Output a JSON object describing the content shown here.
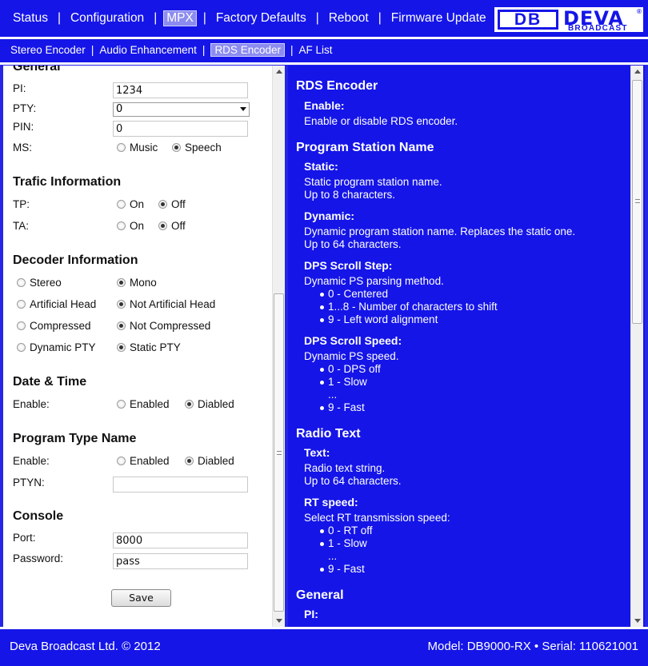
{
  "topnav": {
    "items": [
      "Status",
      "Configuration",
      "MPX",
      "Factory Defaults",
      "Reboot",
      "Firmware Update"
    ],
    "active": "MPX"
  },
  "logo": {
    "db": "DB",
    "name": "DEVA",
    "reg": "®",
    "sub": "BROADCAST"
  },
  "subnav": {
    "items": [
      "Stereo Encoder",
      "Audio Enhancement",
      "RDS Encoder",
      "AF List"
    ],
    "active": "RDS Encoder"
  },
  "form": {
    "general_heading": "General",
    "pi_label": "PI:",
    "pi_value": "1234",
    "pty_label": "PTY:",
    "pty_value": "0",
    "pin_label": "PIN:",
    "pin_value": "0",
    "ms_label": "MS:",
    "ms_music": "Music",
    "ms_speech": "Speech",
    "traffic_heading": "Trafic Information",
    "tp_label": "TP:",
    "ta_label": "TA:",
    "on": "On",
    "off": "Off",
    "decoder_heading": "Decoder Information",
    "stereo": "Stereo",
    "mono": "Mono",
    "artificial_head": "Artificial Head",
    "not_artificial_head": "Not Artificial Head",
    "compressed": "Compressed",
    "not_compressed": "Not Compressed",
    "dynamic_pty": "Dynamic PTY",
    "static_pty": "Static PTY",
    "datetime_heading": "Date & Time",
    "enable_label": "Enable:",
    "enabled": "Enabled",
    "diabled": "Diabled",
    "ptn_heading": "Program Type Name",
    "ptyn_label": "PTYN:",
    "ptyn_value": "",
    "console_heading": "Console",
    "port_label": "Port:",
    "port_value": "8000",
    "password_label": "Password:",
    "password_value": "pass",
    "save_label": "Save"
  },
  "help": {
    "rds_heading": "RDS Encoder",
    "enable_title": "Enable:",
    "enable_text": "Enable or disable RDS encoder.",
    "psn_heading": "Program Station Name",
    "static_title": "Static:",
    "static_text1": "Static program station name.",
    "static_text2": "Up to 8 characters.",
    "dynamic_title": "Dynamic:",
    "dynamic_text1": "Dynamic program station name. Replaces the static one.",
    "dynamic_text2": "Up to 64 characters.",
    "dps_step_title": "DPS Scroll Step:",
    "dps_step_text": "Dynamic PS parsing method.",
    "dps_step_items": [
      "0 - Centered",
      "1...8 - Number of characters to shift",
      "9 - Left word alignment"
    ],
    "dps_speed_title": "DPS Scroll Speed:",
    "dps_speed_text": "Dynamic PS speed.",
    "dps_speed_items": [
      "0 - DPS off",
      "1 - Slow",
      "...",
      "9 - Fast"
    ],
    "rt_heading": "Radio Text",
    "text_title": "Text:",
    "text_text1": "Radio text string.",
    "text_text2": "Up to 64 characters.",
    "rtspeed_title": "RT speed:",
    "rtspeed_text": "Select RT transmission speed:",
    "rtspeed_items": [
      "0 - RT off",
      "1 - Slow",
      "...",
      "9 - Fast"
    ],
    "general_heading": "General",
    "pi_title": "PI:"
  },
  "footer": {
    "left": "Deva Broadcast Ltd. © 2012",
    "right": "Model: DB9000-RX • Serial: 110621001"
  }
}
